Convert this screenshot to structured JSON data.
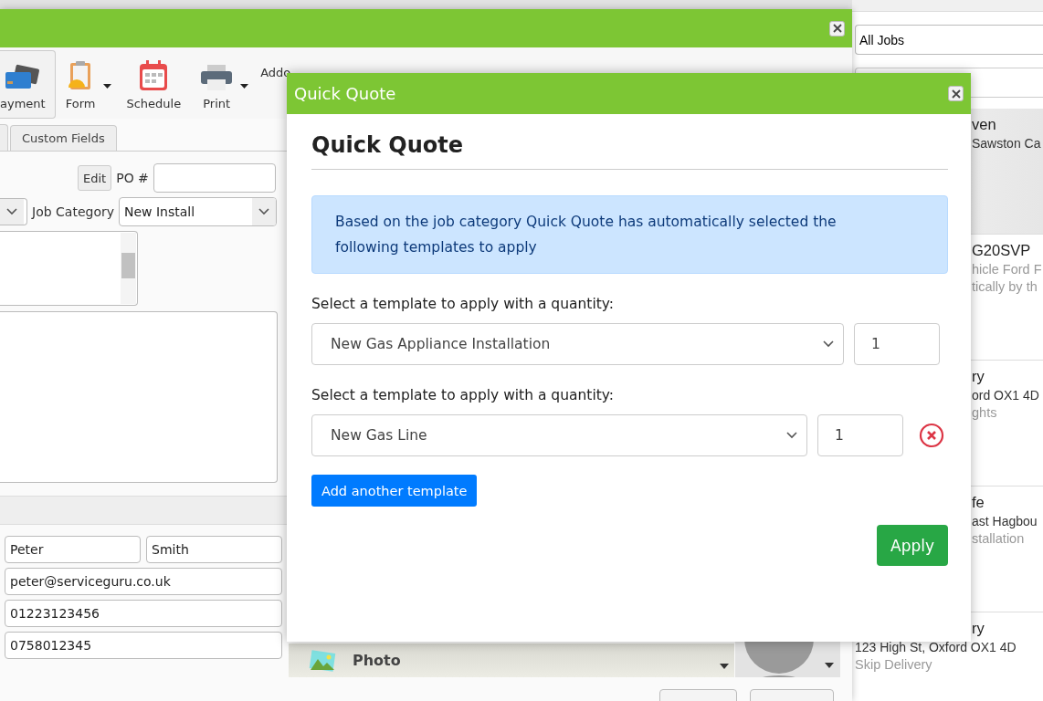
{
  "main_window": {
    "toolbar": [
      {
        "label": "ayment",
        "kind": "payment",
        "pressed": true,
        "dropdown": false
      },
      {
        "label": "Form",
        "kind": "form",
        "pressed": false,
        "dropdown": true
      },
      {
        "label": "Schedule",
        "kind": "schedule",
        "pressed": false,
        "dropdown": false
      },
      {
        "label": "Print",
        "kind": "print",
        "pressed": false,
        "dropdown": true
      }
    ],
    "addons_menu": "Addo",
    "tabs": [
      {
        "label": "Custom Fields",
        "selected": false
      }
    ],
    "edit_button": "Edit",
    "po_label": "PO #",
    "job_category_label": "Job Category",
    "job_category": "New Install",
    "contact": {
      "first_name": "Peter",
      "last_name": "Smith",
      "email": "peter@serviceguru.co.uk",
      "phone": "01223123456",
      "mobile": "0758012345"
    },
    "photo_label": "Photo"
  },
  "jobs_panel": {
    "filter": "All Jobs",
    "jobs": [
      {
        "title": "ven",
        "address": "Sawston Ca",
        "selected": true
      },
      {
        "title": "G20SVP",
        "notes": [
          "hicle Ford F",
          "tically by th"
        ],
        "selected": false
      },
      {
        "title": "ry",
        "address": "ord OX1 4D",
        "notes": [
          "ghts"
        ],
        "selected": false
      },
      {
        "title": "fe",
        "address": "ast Hagbou",
        "notes": [
          "stallation"
        ],
        "selected": false
      },
      {
        "title": "ry",
        "address": "123 High St, Oxford OX1 4D",
        "notes": [
          "Skip Delivery"
        ],
        "selected": false
      }
    ]
  },
  "dialog": {
    "title": "Quick Quote",
    "heading": "Quick Quote",
    "notice": "Based on the job category Quick Quote has automatically selected the following templates to apply",
    "rows": [
      {
        "label": "Select a template to apply with a quantity:",
        "template": "New Gas Appliance Installation",
        "quantity": "1",
        "removable": false
      },
      {
        "label": "Select a template to apply with a quantity:",
        "template": "New Gas Line",
        "quantity": "1",
        "removable": true
      }
    ],
    "add_button": "Add another template",
    "apply_button": "Apply"
  }
}
